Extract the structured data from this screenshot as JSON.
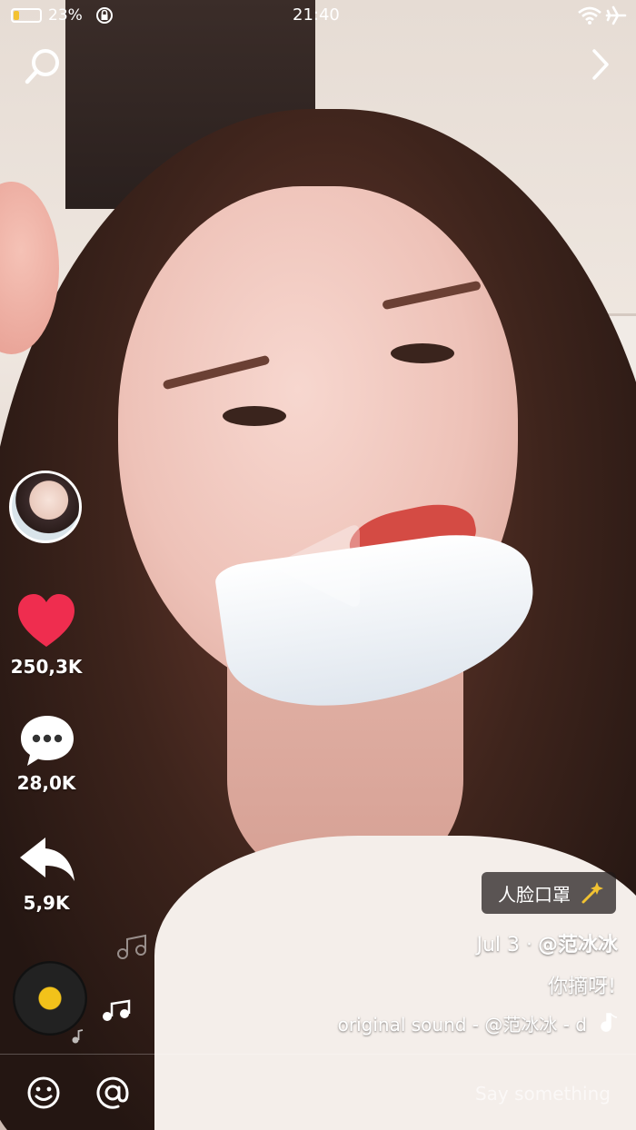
{
  "status_bar": {
    "battery_pct": "23%",
    "battery_level": 0.23,
    "time": "21:40"
  },
  "nav": {
    "search_icon": "search-icon",
    "next_icon": "chevron-right-icon"
  },
  "play_icon": "play-icon",
  "rail": {
    "avatar": "avatar",
    "likes": "250,3K",
    "comments": "28,0K",
    "shares": "5,9K",
    "like_color": "#ef2d4f"
  },
  "effect": {
    "label": "人脸口罩",
    "icon": "magic-wand-icon"
  },
  "post": {
    "author": "@范冰冰",
    "date": "Jul 3 ·",
    "caption": "你摘呀!",
    "music": "original sound - @范冰冰 - d"
  },
  "bottom": {
    "placeholder": "Say something",
    "emoji_icon": "emoji-icon",
    "at_icon": "at-icon"
  }
}
